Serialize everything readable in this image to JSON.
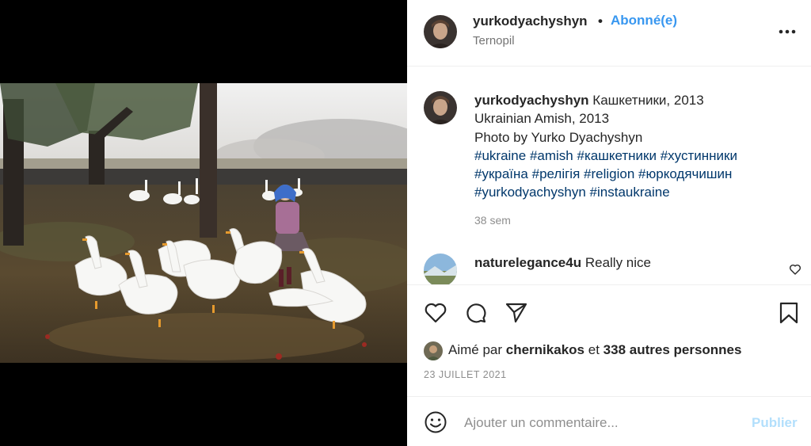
{
  "post": {
    "author": {
      "username": "yurkodyachyshyn",
      "follow_separator": "•",
      "follow_status": "Abonné(e)",
      "location": "Ternopil"
    },
    "photo_icon": "photo-geese-girl"
  },
  "caption": {
    "username": "yurkodyachyshyn",
    "line1": "Кашкетники, 2013",
    "line2": "Ukrainian Amish, 2013",
    "line3": "Photo by Yurko Dyachyshyn",
    "hashtags_line1": [
      "#ukraine",
      "#amish",
      "#кашкетники",
      "#хустинники"
    ],
    "hashtags_line2": [
      "#україна",
      "#релігія",
      "#religion",
      "#юркодячишин"
    ],
    "hashtags_line3": [
      "#yurkodyachyshyn",
      "#instaukraine"
    ],
    "time": "38 sem"
  },
  "comments": [
    {
      "username": "naturelegance4u",
      "text": "Really nice"
    }
  ],
  "actions": {
    "icons": [
      "heart-icon",
      "comment-icon",
      "share-icon",
      "bookmark-icon"
    ]
  },
  "likes": {
    "prefix": "Aimé par",
    "liker": "chernikakos",
    "middle": "et",
    "others": "338 autres personnes"
  },
  "date": "23 JUILLET 2021",
  "add_comment": {
    "placeholder": "Ajouter un commentaire...",
    "publish_label": "Publier"
  },
  "colors": {
    "link_blue": "#3897f0",
    "hashtag": "#00376b",
    "muted": "#8e8e8e",
    "publish_disabled": "#b2dffc",
    "media_bg": "#000000"
  }
}
